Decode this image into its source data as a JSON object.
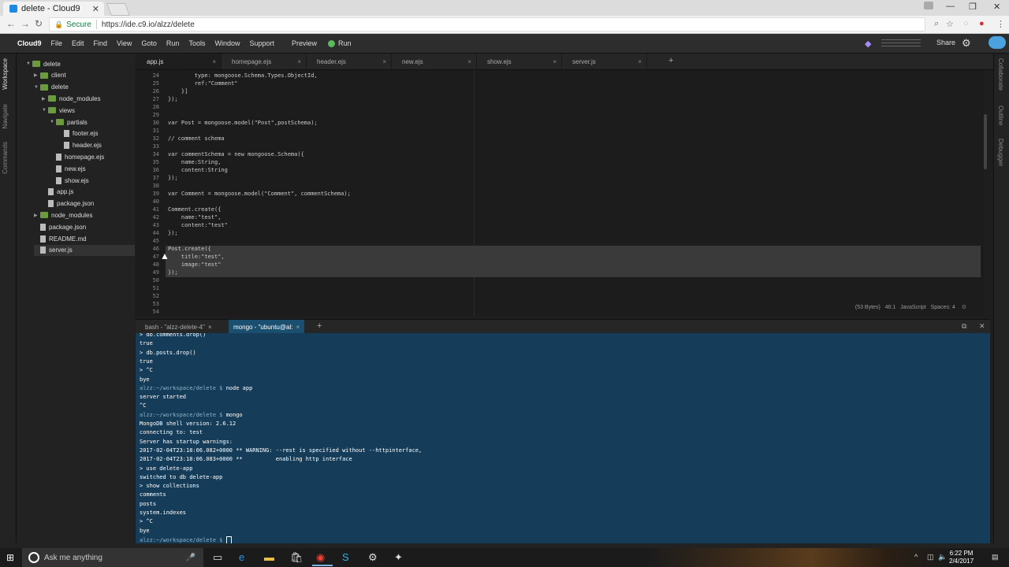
{
  "browser": {
    "tab_title": "delete - Cloud9",
    "secure_label": "Secure",
    "url": "https://ide.c9.io/alzz/delete"
  },
  "menubar": {
    "brand": "Cloud9",
    "items": [
      "File",
      "Edit",
      "Find",
      "View",
      "Goto",
      "Run",
      "Tools",
      "Window",
      "Support",
      "Preview"
    ],
    "run_label": "Run",
    "share_label": "Share"
  },
  "left_tabs": [
    "Workspace",
    "Navigate",
    "Commands"
  ],
  "right_tabs": [
    "Collaborate",
    "Outline",
    "Debugger"
  ],
  "tree": [
    {
      "label": "delete",
      "type": "folder",
      "depth": 0,
      "open": true
    },
    {
      "label": "client",
      "type": "folder",
      "depth": 1,
      "open": false
    },
    {
      "label": "delete",
      "type": "folder",
      "depth": 1,
      "open": true
    },
    {
      "label": "node_modules",
      "type": "folder",
      "depth": 2,
      "open": false
    },
    {
      "label": "views",
      "type": "folder",
      "depth": 2,
      "open": true
    },
    {
      "label": "partials",
      "type": "folder",
      "depth": 3,
      "open": true
    },
    {
      "label": "footer.ejs",
      "type": "file",
      "depth": 4
    },
    {
      "label": "header.ejs",
      "type": "file",
      "depth": 4
    },
    {
      "label": "homepage.ejs",
      "type": "file",
      "depth": 3
    },
    {
      "label": "new.ejs",
      "type": "file",
      "depth": 3
    },
    {
      "label": "show.ejs",
      "type": "file",
      "depth": 3
    },
    {
      "label": "app.js",
      "type": "file",
      "depth": 2
    },
    {
      "label": "package.json",
      "type": "file",
      "depth": 2
    },
    {
      "label": "node_modules",
      "type": "folder",
      "depth": 1,
      "open": false
    },
    {
      "label": "package.json",
      "type": "file",
      "depth": 1
    },
    {
      "label": "README.md",
      "type": "file",
      "depth": 1
    },
    {
      "label": "server.js",
      "type": "file",
      "depth": 1,
      "selected": true
    }
  ],
  "editor_tabs": [
    "app.js",
    "homepage.ejs",
    "header.ejs",
    "new.ejs",
    "show.ejs",
    "server.js"
  ],
  "editor": {
    "lines": [
      {
        "n": "24",
        "text": "        type: mongoose.Schema.Types.ObjectId,"
      },
      {
        "n": "25",
        "text": "        ref:\"Comment\""
      },
      {
        "n": "26",
        "text": "    }]"
      },
      {
        "n": "27",
        "text": "});"
      },
      {
        "n": "28",
        "text": ""
      },
      {
        "n": "29",
        "text": ""
      },
      {
        "n": "30",
        "text": "var Post = mongoose.model(\"Post\",postSchema);"
      },
      {
        "n": "31",
        "text": ""
      },
      {
        "n": "32",
        "text": "// comment schema"
      },
      {
        "n": "33",
        "text": ""
      },
      {
        "n": "34",
        "text": "var commentSchema = new mongoose.Schema({"
      },
      {
        "n": "35",
        "text": "    name:String,"
      },
      {
        "n": "36",
        "text": "    content:String"
      },
      {
        "n": "37",
        "text": "});"
      },
      {
        "n": "38",
        "text": ""
      },
      {
        "n": "39",
        "text": "var Comment = mongoose.model(\"Comment\", commentSchema);"
      },
      {
        "n": "40",
        "text": ""
      },
      {
        "n": "41",
        "text": "Comment.create({"
      },
      {
        "n": "42",
        "text": "    name:\"test\","
      },
      {
        "n": "43",
        "text": "    content:\"test\""
      },
      {
        "n": "44",
        "text": "});"
      },
      {
        "n": "45",
        "text": ""
      },
      {
        "n": "46",
        "text": "Post.create({"
      },
      {
        "n": "47",
        "text": "    title:\"test\","
      },
      {
        "n": "48",
        "text": "    image:\"test\""
      },
      {
        "n": "49",
        "text": "});"
      },
      {
        "n": "50",
        "text": ""
      },
      {
        "n": "51",
        "text": ""
      },
      {
        "n": "52",
        "text": ""
      },
      {
        "n": "53",
        "text": ""
      },
      {
        "n": "54",
        "text": ""
      }
    ],
    "status": {
      "bytes": "(53 Bytes)",
      "position": "46:1",
      "language": "JavaScript",
      "spaces": "Spaces: 4"
    }
  },
  "terminal_tabs": [
    "bash - \"alzz-delete-4\"",
    "mongo - \"ubuntu@al:"
  ],
  "terminal_lines": [
    {
      "prompt": "",
      "text": "> db.comments.drop()"
    },
    {
      "prompt": "",
      "text": "true"
    },
    {
      "prompt": "",
      "text": "> db.posts.drop()"
    },
    {
      "prompt": "",
      "text": "true"
    },
    {
      "prompt": "",
      "text": "> ^C"
    },
    {
      "prompt": "",
      "text": "bye"
    },
    {
      "prompt": "alzz:~/workspace/delete $ ",
      "text": "node app"
    },
    {
      "prompt": "",
      "text": "server started"
    },
    {
      "prompt": "",
      "text": "^C"
    },
    {
      "prompt": "alzz:~/workspace/delete $ ",
      "text": "mongo"
    },
    {
      "prompt": "",
      "text": "MongoDB shell version: 2.6.12"
    },
    {
      "prompt": "",
      "text": "connecting to: test"
    },
    {
      "prompt": "",
      "text": "Server has startup warnings:"
    },
    {
      "prompt": "",
      "text": "2017-02-04T23:18:06.082+0000 ** WARNING: --rest is specified without --httpinterface,"
    },
    {
      "prompt": "",
      "text": "2017-02-04T23:18:06.083+0000 **          enabling http interface"
    },
    {
      "prompt": "",
      "text": "> use delete-app"
    },
    {
      "prompt": "",
      "text": "switched to db delete-app"
    },
    {
      "prompt": "",
      "text": "> show collections"
    },
    {
      "prompt": "",
      "text": "comments"
    },
    {
      "prompt": "",
      "text": "posts"
    },
    {
      "prompt": "",
      "text": "system.indexes"
    },
    {
      "prompt": "",
      "text": "> ^C"
    },
    {
      "prompt": "",
      "text": "bye"
    },
    {
      "prompt": "alzz:~/workspace/delete $ ",
      "text": ""
    }
  ],
  "taskbar": {
    "search_placeholder": "Ask me anything",
    "time": "6:22 PM",
    "date": "2/4/2017"
  }
}
